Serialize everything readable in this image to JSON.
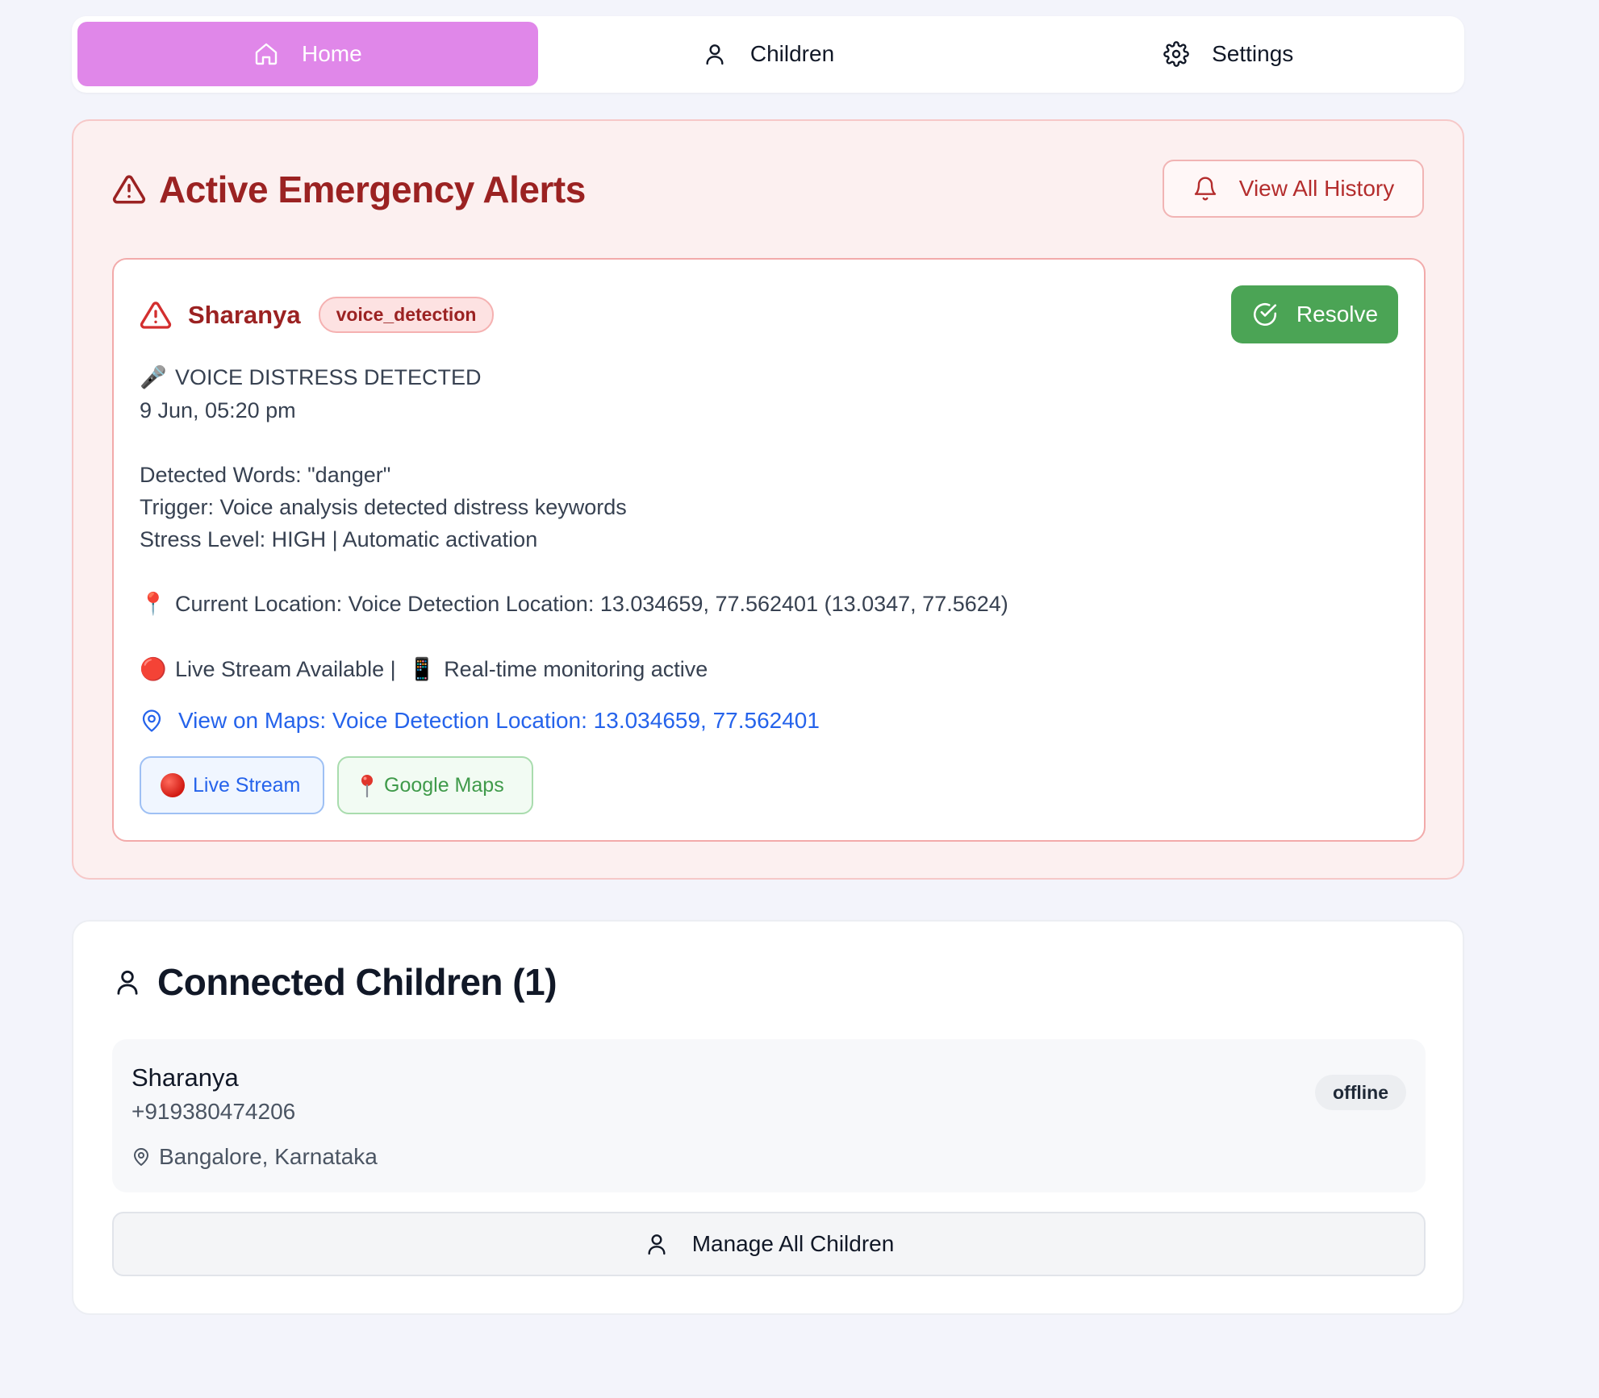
{
  "nav": {
    "tabs": [
      {
        "label": "Home",
        "icon": "home-icon",
        "active": true
      },
      {
        "label": "Children",
        "icon": "user-icon",
        "active": false
      },
      {
        "label": "Settings",
        "icon": "gear-icon",
        "active": false
      }
    ]
  },
  "alerts": {
    "title": "Active Emergency Alerts",
    "history_label": "View All History",
    "card": {
      "name": "Sharanya",
      "type_badge": "voice_detection",
      "resolve_label": "Resolve",
      "heading": "VOICE DISTRESS DETECTED",
      "heading_emoji": "🎤",
      "timestamp": "9 Jun, 05:20 pm",
      "detected_words": "Detected Words: \"danger\"",
      "trigger": "Trigger: Voice analysis detected distress keywords",
      "stress": "Stress Level: HIGH | Automatic activation",
      "location": "Current Location: Voice Detection Location: 13.034659, 77.562401 (13.0347, 77.5624)",
      "location_emoji": "📍",
      "stream_status": "Live Stream Available |",
      "stream_emoji": "🔴",
      "monitoring": "Real-time monitoring active",
      "monitoring_emoji": "📱",
      "maps_link": "View on Maps: Voice Detection Location: 13.034659, 77.562401",
      "live_stream_btn": "Live Stream",
      "google_maps_btn": "Google Maps"
    }
  },
  "children": {
    "title": "Connected Children (1)",
    "list": [
      {
        "name": "Sharanya",
        "phone": "+919380474206",
        "location": "Bangalore, Karnataka",
        "status": "offline"
      }
    ],
    "manage_label": "Manage All Children"
  },
  "colors": {
    "accent_pink": "#e087e9",
    "alert_red": "#9b2222",
    "resolve_green": "#4ba455",
    "link_blue": "#2563eb"
  }
}
